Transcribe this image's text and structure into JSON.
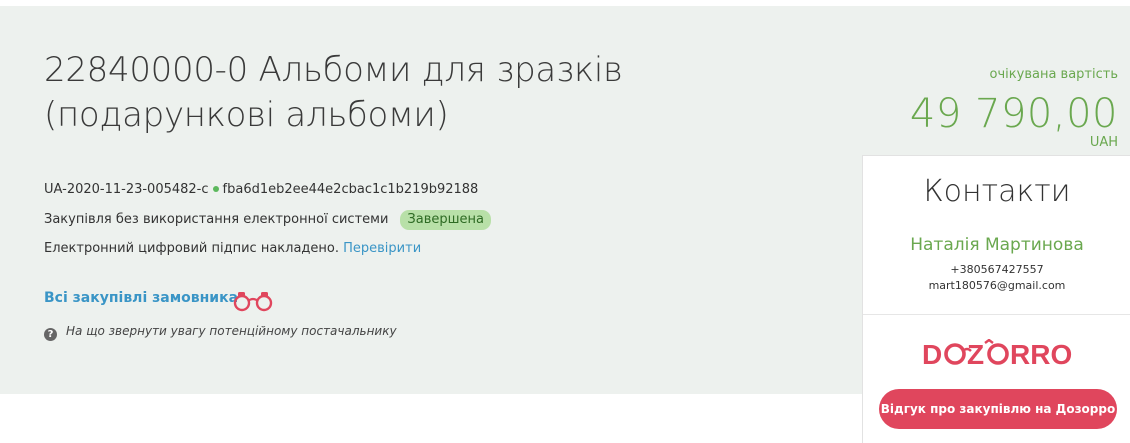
{
  "tender": {
    "title": "22840000-0 Альбоми для зразків (подарункові альбоми)",
    "id": "UA-2020-11-23-005482-c",
    "hash": "fba6d1eb2ee44e2cbac1c1b219b92188",
    "procedure": "Закупівля без використання електронної системи",
    "status": "Завершена",
    "signature_text": "Електронний цифровий підпис накладено.",
    "verify_link": "Перевірити",
    "all_purchases_link": "Всі закупівлі замовника",
    "supplier_note": "На що звернути увагу потенційному постачальнику"
  },
  "expected": {
    "label": "очікувана вартість",
    "value": "49 790,00",
    "currency": "UAH"
  },
  "contacts": {
    "title": "Контакти",
    "name": "Наталія Мартинова",
    "phone": "+380567427557",
    "email": "mart180576@gmail.com"
  },
  "dozorro": {
    "logo_text": "DOZORRO",
    "cta": "Відгук про закупівлю на Дозорро"
  },
  "colors": {
    "accent_green": "#6aa84f",
    "link_blue": "#3a95c6",
    "brand_red": "#e0465d",
    "panel_bg": "#edf1ee"
  }
}
